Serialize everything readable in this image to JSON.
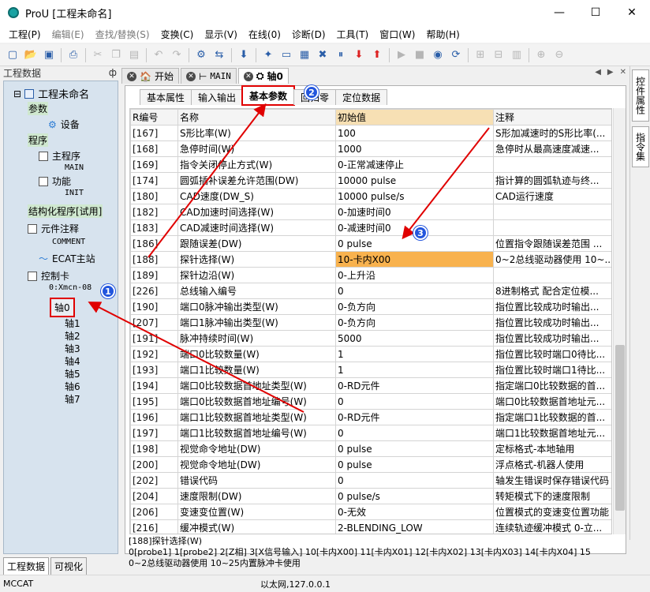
{
  "window": {
    "title": "ProU [工程未命名]",
    "minimize": "—",
    "maximize": "☐",
    "close": "✕"
  },
  "menu": [
    "工程(P)",
    "编辑(E)",
    "查找/替换(S)",
    "变换(C)",
    "显示(V)",
    "在线(0)",
    "诊断(D)",
    "工具(T)",
    "窗口(W)",
    "帮助(H)"
  ],
  "menu_disabled": [
    false,
    true,
    true,
    false,
    false,
    false,
    false,
    false,
    false,
    false
  ],
  "left_panel": {
    "title": "工程数据",
    "pin": "ф",
    "tree": {
      "root": "工程未命名",
      "params": "参数",
      "device": "设备",
      "program": "程序",
      "main_program": "主程序",
      "main": "MAIN",
      "function": "功能",
      "init": "INIT",
      "structured": "结构化程序[试用]",
      "comments": "元件注释",
      "comment": "COMMENT",
      "ecat": "ECAT主站",
      "control_card": "控制卡",
      "xmcn": "0:Xmcn-08",
      "axes": [
        "轴0",
        "轴1",
        "轴2",
        "轴3",
        "轴4",
        "轴5",
        "轴6",
        "轴7"
      ]
    },
    "tabs": [
      "工程数据",
      "可视化"
    ]
  },
  "doc_tabs": [
    {
      "label": "开始"
    },
    {
      "label": "MAIN"
    },
    {
      "label": "轴0"
    }
  ],
  "right_tabs": [
    "控件属性",
    "指令集"
  ],
  "sub_tabs": [
    "基本属性",
    "输入输出",
    "基本参数",
    "回归零",
    "定位数据"
  ],
  "sub_tab_hidden_prefix": "回",
  "table": {
    "headers": [
      "R编号",
      "名称",
      "初始值",
      "注释"
    ],
    "rows": [
      [
        "[167]",
        "S形比率(W)",
        "100",
        "S形加减速时的S形比率(..."
      ],
      [
        "[168]",
        "急停时间(W)",
        "1000",
        "急停时从最高速度减速..."
      ],
      [
        "[169]",
        "指令关闭停止方式(W)",
        "0-正常减速停止",
        ""
      ],
      [
        "[174]",
        "圆弧插补误差允许范围(DW)",
        "10000 pulse",
        "指计算的圆弧轨迹与终..."
      ],
      [
        "[180]",
        "CAD速度(DW_S)",
        "10000 pulse/s",
        "CAD运行速度"
      ],
      [
        "[182]",
        "CAD加速时间选择(W)",
        "0-加速时间0",
        ""
      ],
      [
        "[183]",
        "CAD减速时间选择(W)",
        "0-减速时间0",
        ""
      ],
      [
        "[186]",
        "跟随误差(DW)",
        "0 pulse",
        "位置指令跟随误差范围 ..."
      ],
      [
        "[188]",
        "探针选择(W)",
        "10-卡内X00",
        "0~2总线驱动器使用 10~..."
      ],
      [
        "[189]",
        "探针边沿(W)",
        "0-上升沿",
        ""
      ],
      [
        "[226]",
        "总线输入编号",
        "0",
        "8进制格式 配合定位模..."
      ],
      [
        "[190]",
        "端口0脉冲输出类型(W)",
        "0-负方向",
        "指位置比较成功时输出..."
      ],
      [
        "[207]",
        "端口1脉冲输出类型(W)",
        "0-负方向",
        "指位置比较成功时输出..."
      ],
      [
        "[191]",
        "脉冲持续时间(W)",
        "5000",
        "指位置比较成功时输出..."
      ],
      [
        "[192]",
        "端口0比较数量(W)",
        "1",
        "指位置比较时端口0待比..."
      ],
      [
        "[193]",
        "端口1比较数量(W)",
        "1",
        "指位置比较时端口1待比..."
      ],
      [
        "[194]",
        "端口0比较数据首地址类型(W)",
        "0-RD元件",
        "指定端口0比较数据的首..."
      ],
      [
        "[195]",
        "端口0比较数据首地址编号(W)",
        "0",
        "端口0比较数据首地址元..."
      ],
      [
        "[196]",
        "端口1比较数据首地址类型(W)",
        "0-RD元件",
        "指定端口1比较数据的首..."
      ],
      [
        "[197]",
        "端口1比较数据首地址编号(W)",
        "0",
        "端口1比较数据首地址元..."
      ],
      [
        "[198]",
        "视觉命令地址(DW)",
        "0 pulse",
        "定标格式-本地轴用"
      ],
      [
        "[200]",
        "视觉命令地址(DW)",
        "0 pulse",
        "浮点格式-机器人使用"
      ],
      [
        "[202]",
        "错误代码",
        "0",
        "轴发生错误时保存错误代码"
      ],
      [
        "[204]",
        "速度限制(DW)",
        "0 pulse/s",
        "转矩模式下的速度限制"
      ],
      [
        "[206]",
        "变速变位置(W)",
        "0-无效",
        "位置模式的变速变位置功能"
      ],
      [
        "[216]",
        "缓冲模式(W)",
        "2-BLENDING_LOW",
        "连续轨迹缓冲模式 0-立..."
      ]
    ],
    "selected_row": 8
  },
  "description": {
    "line1": "[188]探针选择(W)",
    "line2": "0[probe1] 1[probe2] 2[Z相] 3[X信号输入] 10[卡内X00] 11[卡内X01] 12[卡内X02] 13[卡内X03] 14[卡内X04] 15",
    "line3": "0~2总线驱动器使用 10~25内置脉冲卡使用"
  },
  "status": {
    "left": "MCCAT",
    "center": "以太网,127.0.0.1"
  },
  "annotations": [
    "1",
    "2",
    "3"
  ],
  "colors": {
    "highlight_red": "#e00000",
    "badge_blue": "#2255dd",
    "selected_cell": "#f8b24e",
    "tree_bg": "#d7e3ee"
  }
}
